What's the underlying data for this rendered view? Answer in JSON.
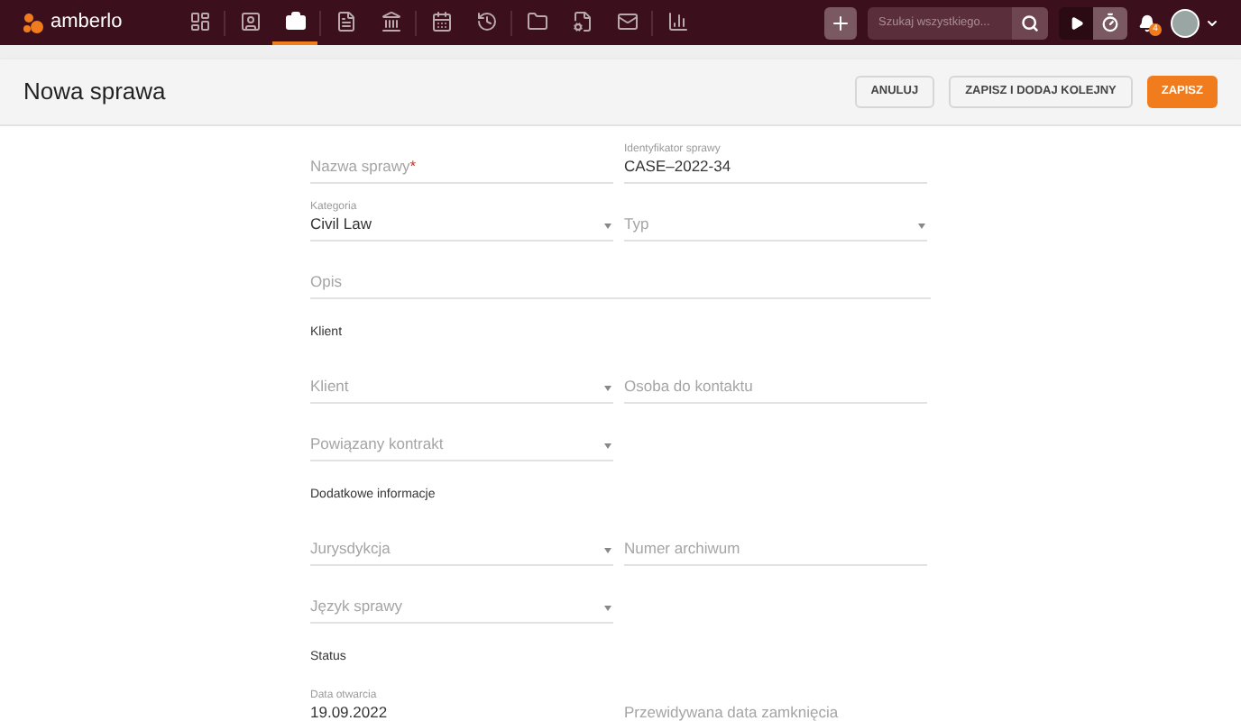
{
  "nav": {
    "logo": "amberlo",
    "items": [
      {
        "selected": false
      },
      {
        "selected": false
      },
      {
        "selected": true
      },
      {
        "selected": false
      },
      {
        "selected": false
      },
      {
        "selected": false
      },
      {
        "selected": false
      },
      {
        "selected": false
      },
      {
        "selected": false
      },
      {
        "selected": false
      },
      {
        "selected": false
      }
    ],
    "search": {
      "placeholder": "Szukaj wszystkiego..."
    },
    "timer_active": true,
    "notifications": "4"
  },
  "header": {
    "title": "Nowa sprawa",
    "buttons": [
      {
        "label": "ANULUJ",
        "kind": "secondary"
      },
      {
        "label": "ZAPISZ I DODAJ KOLEJNY",
        "kind": "secondary"
      },
      {
        "label": "ZAPISZ",
        "kind": "primary"
      }
    ]
  },
  "form": [
    {
      "kind": "fields",
      "fields": [
        {
          "placeholder": "Nazwa sprawy",
          "required_mark": "*",
          "dropdown": false
        },
        {
          "label": "Identyfikator sprawy",
          "value": "CASE–2022-34",
          "dropdown": false
        }
      ]
    },
    {
      "kind": "fields",
      "fields": [
        {
          "label": "Kategoria",
          "value": "Civil Law",
          "dropdown": true
        },
        {
          "placeholder": "Typ",
          "dropdown": true
        }
      ]
    },
    {
      "kind": "fields",
      "fields": [
        {
          "placeholder": "Opis",
          "dropdown": false,
          "wide": true
        }
      ]
    },
    {
      "kind": "heading",
      "text": "Klient"
    },
    {
      "kind": "fields",
      "fields": [
        {
          "placeholder": "Klient",
          "dropdown": true
        },
        {
          "placeholder": "Osoba do kontaktu",
          "dropdown": false
        }
      ]
    },
    {
      "kind": "fields",
      "fields": [
        {
          "placeholder": "Powiązany kontrakt",
          "dropdown": true
        }
      ]
    },
    {
      "kind": "heading",
      "text": "Dodatkowe informacje"
    },
    {
      "kind": "fields",
      "fields": [
        {
          "placeholder": "Jurysdykcja",
          "dropdown": true
        },
        {
          "placeholder": "Numer archiwum",
          "dropdown": false
        }
      ]
    },
    {
      "kind": "fields",
      "fields": [
        {
          "placeholder": "Język sprawy",
          "dropdown": true
        }
      ]
    },
    {
      "kind": "heading",
      "text": "Status"
    },
    {
      "kind": "fields",
      "fields": [
        {
          "label": "Data otwarcia",
          "value": "19.09.2022",
          "dropdown": false,
          "no_line": true
        },
        {
          "placeholder": "Przewidywana data zamknięcia",
          "dropdown": false,
          "no_line": true
        }
      ]
    }
  ]
}
